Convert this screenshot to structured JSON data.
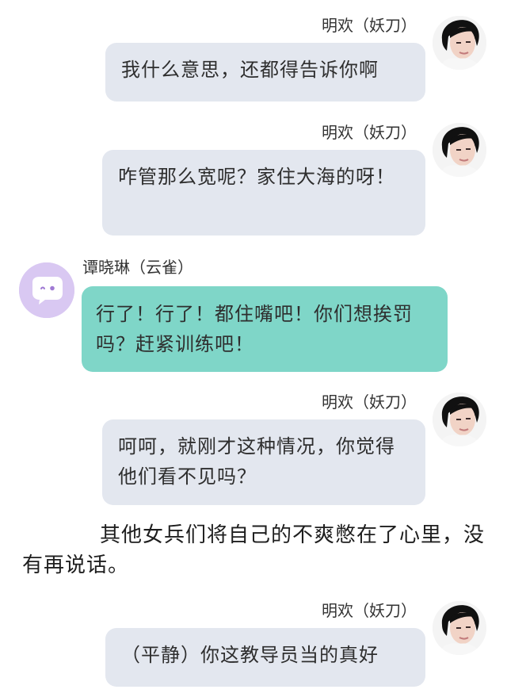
{
  "messages": [
    {
      "speaker": "明欢（妖刀）",
      "text": "我什么意思，还都得告诉你啊"
    },
    {
      "speaker": "明欢（妖刀）",
      "text": "咋管那么宽呢？家住大海的呀！"
    },
    {
      "speaker": "谭晓琳（云雀）",
      "text": "行了！行了！都住嘴吧！你们想挨罚吗？赶紧训练吧！"
    },
    {
      "speaker": "明欢（妖刀）",
      "text": "呵呵，就刚才这种情况，你觉得他们看不见吗？"
    },
    {
      "speaker": "明欢（妖刀）",
      "text": "（平静）你这教导员当的真好"
    }
  ],
  "narration": "其他女兵们将自己的不爽憋在了心里，没有再说话。",
  "colors": {
    "right_bubble": "#e3e7ef",
    "left_bubble": "#7fd6c8",
    "left_avatar": "#d9c8f2"
  },
  "icons": {
    "left_avatar": "chat-bubble-face-icon"
  }
}
